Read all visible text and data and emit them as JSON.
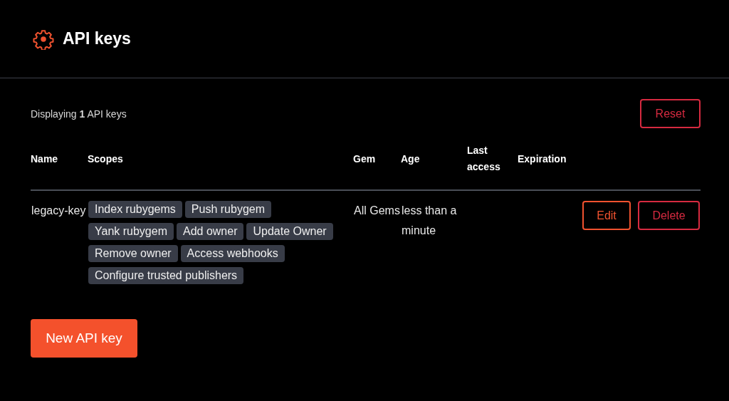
{
  "header": {
    "title": "API keys"
  },
  "summary": "Displaying **1** API keys",
  "reset_button": "Reset",
  "table": {
    "columns": [
      "Name",
      "Scopes",
      "Gem",
      "Age",
      "Last access",
      "Expiration"
    ],
    "rows": [
      {
        "name": "legacy-key",
        "scopes": [
          "Index rubygems",
          "Push rubygem",
          "Yank rubygem",
          "Add owner",
          "Update Owner",
          "Remove owner",
          "Access webhooks",
          "Configure trusted publishers"
        ],
        "gem": "All Gems",
        "age": "less than a minute",
        "actions": [
          {
            "label": "Edit",
            "kind": "edit"
          },
          {
            "label": "Delete",
            "kind": "delete"
          }
        ]
      }
    ]
  },
  "new_button": "New API key"
}
